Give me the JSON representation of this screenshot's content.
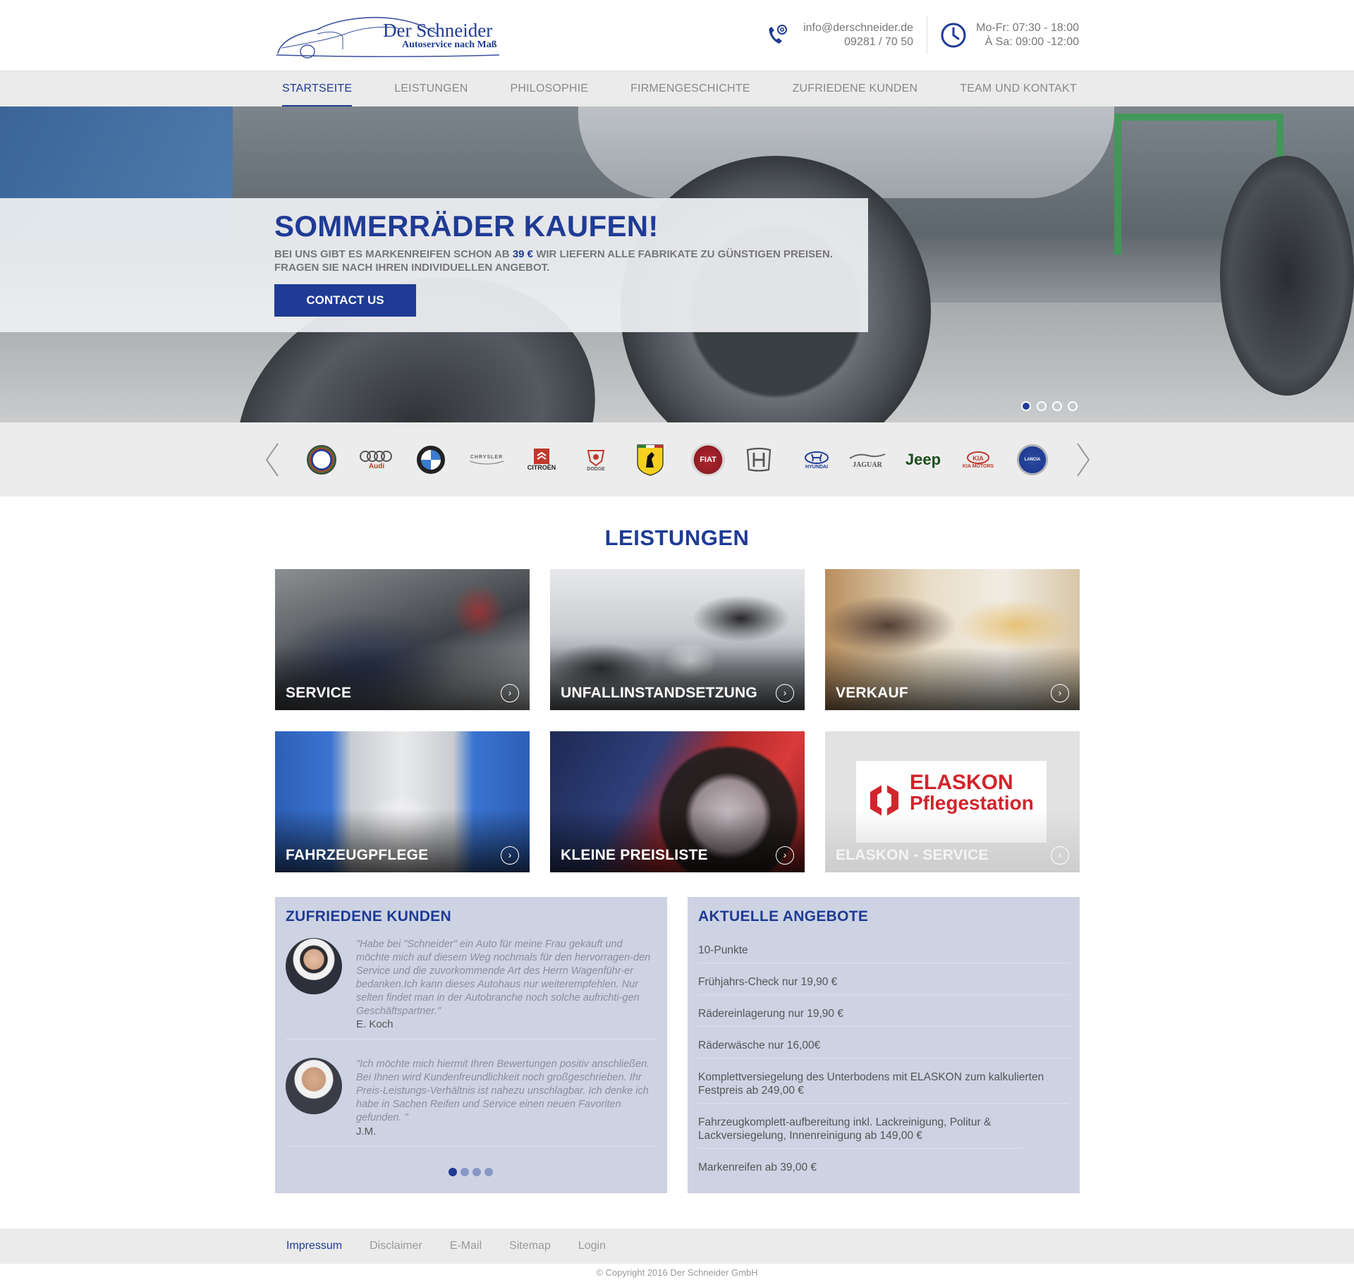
{
  "brand": {
    "name": "Der Schneider",
    "tagline": "Autoservice nach Maß"
  },
  "header": {
    "email": "info@derschneider.de",
    "phone": "09281 / 70 50",
    "hours_weekday": "Mo-Fr: 07:30 - 18:00",
    "hours_saturday": "À Sa: 09:00 -12:00"
  },
  "nav": {
    "items": [
      {
        "label": "STARTSEITE"
      },
      {
        "label": "LEISTUNGEN"
      },
      {
        "label": "PHILOSOPHIE"
      },
      {
        "label": "FIRMENGESCHICHTE"
      },
      {
        "label": "ZUFRIEDENE KUNDEN"
      },
      {
        "label": "TEAM UND KONTAKT"
      }
    ]
  },
  "hero": {
    "title": "SOMMERRÄDER KAUFEN!",
    "text_before_price": "BEI UNS GIBT ES MARKENREIFEN SCHON AB",
    "price": "39 €",
    "text_after_price": "WIR LIEFERN ALLE FABRIKATE ZU GÜNSTIGEN PREISEN.",
    "text_line2": "FRAGEN SIE NACH IHREN INDIVIDUELLEN ANGEBOT.",
    "button_label": "CONTACT US",
    "slide_count": 4,
    "active_slide": 1
  },
  "brands": {
    "items": [
      {
        "name": "Alfa Romeo",
        "label": ""
      },
      {
        "name": "Audi",
        "label": "Audi"
      },
      {
        "name": "BMW",
        "label": ""
      },
      {
        "name": "Chrysler",
        "label": "CHRYSLER"
      },
      {
        "name": "Citroën",
        "label": "CITROËN"
      },
      {
        "name": "Dodge",
        "label": "DODGE"
      },
      {
        "name": "Ferrari",
        "label": ""
      },
      {
        "name": "Fiat",
        "label": "FIAT"
      },
      {
        "name": "Honda",
        "label": ""
      },
      {
        "name": "Hyundai",
        "label": "HYUNDAI"
      },
      {
        "name": "Jaguar",
        "label": "JAGUAR"
      },
      {
        "name": "Jeep",
        "label": "Jeep"
      },
      {
        "name": "Kia",
        "label": "KIA MOTORS"
      },
      {
        "name": "Lancia",
        "label": "LANCIA"
      }
    ]
  },
  "services": {
    "title": "LEISTUNGEN",
    "tiles": [
      {
        "label": "SERVICE"
      },
      {
        "label": "UNFALLINSTANDSETZUNG"
      },
      {
        "label": "VERKAUF"
      },
      {
        "label": "FAHRZEUGPFLEGE"
      },
      {
        "label": "KLEINE PREISLISTE"
      },
      {
        "label": "ELASKON - SERVICE"
      }
    ],
    "elaskon_line1": "ELASKON",
    "elaskon_line2": "Pflegestation"
  },
  "testimonials": {
    "title": "ZUFRIEDENE KUNDEN",
    "items": [
      {
        "quote": "\"Habe bei \"Schneider\" ein Auto für meine Frau gekauft und möchte mich auf diesem Weg nochmals für den hervorragen-den Service und die zuvorkommende Art des Herrn Wagenführ-er bedanken.Ich kann dieses Autohaus nur weiterempfehlen. Nur selten findet man in der Autobranche noch solche aufrichti-gen Geschäftspartner.\"",
        "author": "E. Koch"
      },
      {
        "quote": "\"Ich möchte mich hiermit Ihren Bewertungen positiv anschließen. Bei Ihnen wird Kundenfreundlichkeit noch großgeschrieben. Ihr Preis-Leistungs-Verhältnis ist nahezu unschlagbar. Ich denke ich habe in Sachen Reifen und Service einen neuen Favoriten gefunden. \"",
        "author": "J.M."
      }
    ],
    "page_count": 4,
    "active_page": 1
  },
  "offers": {
    "title": "AKTUELLE ANGEBOTE",
    "items": [
      "10-Punkte",
      "Frühjahrs-Check nur 19,90 €",
      "Rädereinlagerung nur 19,90 €",
      "Räderwäsche nur 16,00€",
      "Komplettversiegelung des Unterbodens mit ELASKON zum kalkulierten Festpreis ab 249,00 €",
      "Fahrzeugkomplett-aufbereitung inkl. Lackreinigung, Politur & Lackversiegelung, Innenreinigung ab 149,00 €",
      "Markenreifen ab 39,00 €"
    ]
  },
  "footer": {
    "links": [
      {
        "label": "Impressum"
      },
      {
        "label": "Disclaimer"
      },
      {
        "label": "E-Mail"
      },
      {
        "label": "Sitemap"
      },
      {
        "label": "Login"
      }
    ],
    "copyright": "© Copyright 2016 Der Schneider GmbH"
  },
  "colors": {
    "primary": "#1f3b95",
    "panel": "#cdd3e3",
    "nav_bg": "#ebebeb"
  }
}
